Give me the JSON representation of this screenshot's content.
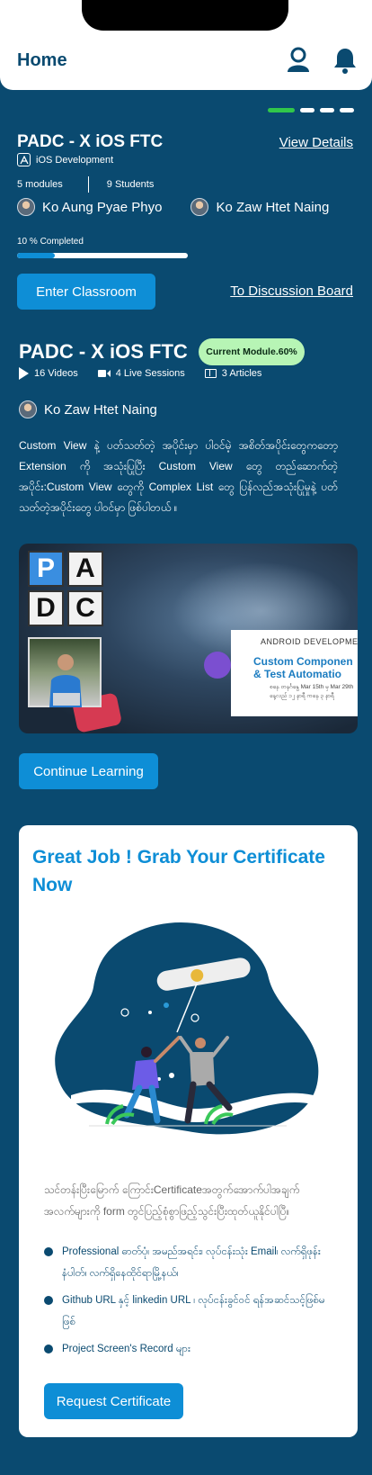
{
  "header": {
    "title": "Home",
    "icons": [
      "user-icon",
      "bell-icon"
    ]
  },
  "pager": {
    "total": 4,
    "active": 1
  },
  "course": {
    "title": "PADC - X iOS FTC",
    "view_details": "View Details",
    "department": "iOS Development",
    "modules": "5 modules",
    "students": "9 Students",
    "instructors": [
      "Ko Aung Pyae Phyo",
      "Ko Zaw Htet Naing"
    ],
    "progress_label": "10 % Completed",
    "progress_fraction": 0.22,
    "enter_button": "Enter Classroom",
    "discussion_link": "To Discussion Board"
  },
  "module": {
    "title": "PADC - X iOS FTC",
    "badge": "Current Module.60%",
    "videos": "16 Videos",
    "live_sessions": "4 Live Sessions",
    "articles": "3 Articles",
    "teacher": "Ko Zaw Htet Naing",
    "description": "Custom View နဲ့ ပတ်သတ်တဲ့ အပိုင်းမှာ ပါဝင်မဲ့ အစိတ်အပိုင်းတွေကတော့ Extension ကို အသုံးပြုပြီး Custom View တွေ တည်ဆောက်တဲ့ အပိုင်း:Custom View တွေကို Complex List တွေ ပြန်လည်အသုံးပြုမှုနဲ့ ပတ်သတ်တဲ့အပိုင်းတွေ ပါဝင်မှာ ဖြစ်ပါတယ် ။",
    "thumbnail": {
      "logo_letters": [
        "P",
        "A",
        "D",
        "C"
      ],
      "slide_header": "ANDROID DEVELOPMEN",
      "slide_title_1": "Custom Componen",
      "slide_title_2": "& Test Automatio",
      "slide_sub_1": "စနေ တနင်္ဂနွေ Mar 15th မှ Mar 29th",
      "slide_sub_2": "နေ့လည် ၁၂ နာရီ ကနေ ၃ နာရီ"
    },
    "continue_button": "Continue Learning"
  },
  "certificate": {
    "title": "Great Job ! Grab Your Certificate Now",
    "description": "သင်တန်းပြီးမြောက် ကြောင်းCertificateအတွက်အောက်ပါအချက် အလက်များကို form တွင်ပြည့်စုံစွာဖြည့်သွင်းပြီးထုတ်ယူနိုင်ပါပြီ။",
    "requirements": [
      "Professional ဓာတ်ပုံ၊ အမည်အရင်း၊ လုပ်ငန်းသုံး Email၊ လက်ရှိဖုန်းနံပါတ်၊ လက်ရှိနေထိုင်ရာမြို့နယ်၊",
      "Github URL နှင့် linkedin URL ၊ လုပ်ငန်းခွင်ဝင် ရန်အဆင်သင့်ဖြစ်မဖြစ်",
      "Project Screen's Record များ"
    ],
    "request_button": "Request Certificate"
  },
  "colors": {
    "primary": "#0a4a70",
    "accent": "#0e8ed6",
    "pager_active": "#31c74a",
    "badge": "#b7f5b5"
  }
}
